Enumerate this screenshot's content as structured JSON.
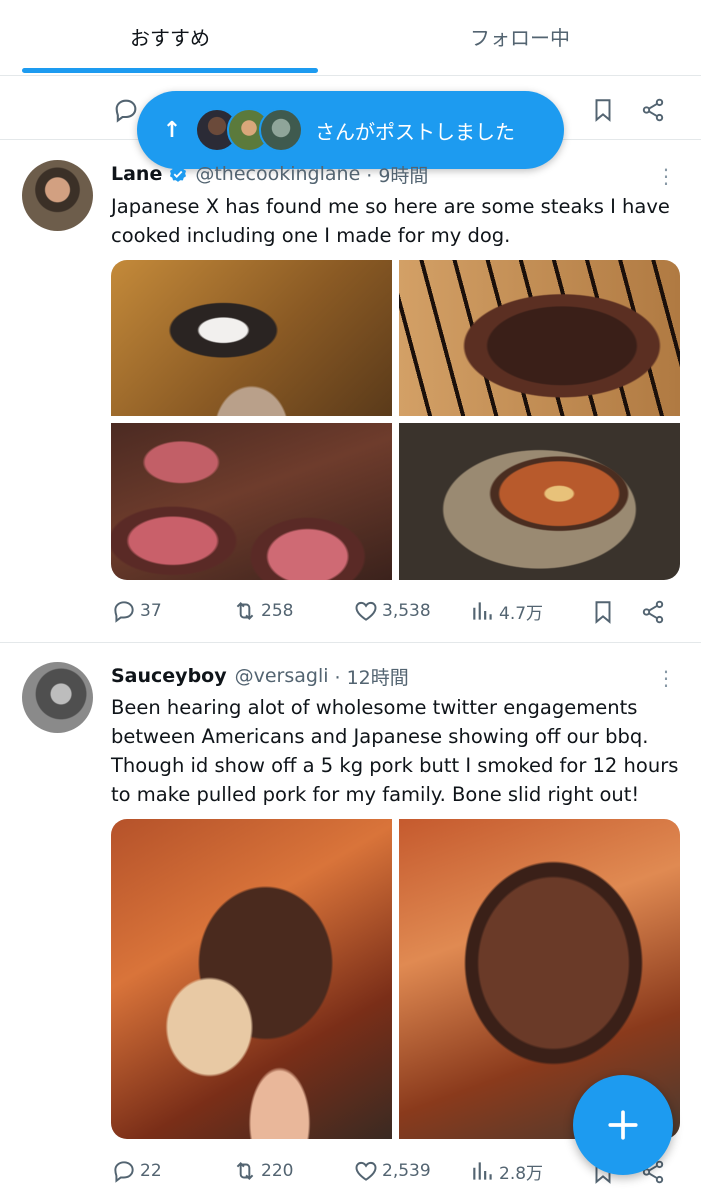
{
  "tabs": [
    {
      "label": "おすすめ"
    },
    {
      "label": "フォロー中"
    }
  ],
  "new_posts_pill": {
    "label": "さんがポストしました"
  },
  "tweets": [
    {
      "name": "Lane",
      "verified": true,
      "handle": "@thecookinglane",
      "time": "· 9時間",
      "text_lines": [
        "Japanese X has found me so here are some steaks I have",
        "cooked including one I made for my dog."
      ],
      "images": [
        "dog-on-tile-floor",
        "grilled-tomahawk-steak",
        "sliced-beef-tenderloin",
        "steak-in-cast-iron-pan"
      ],
      "replies": "37",
      "reposts": "258",
      "likes": "3,538",
      "views": "4.7万"
    },
    {
      "name": "Sauceyboy",
      "verified": false,
      "handle": "@versagli",
      "time": "· 12時間",
      "text_lines": [
        "Been hearing alot of wholesome twitter engagements",
        "between Americans and Japanese showing off our bbq.",
        "Though id show off a 5 kg pork butt I smoked for 12 hours",
        "to make pulled pork for my family. Bone slid right out!"
      ],
      "images": [
        "pork-butt-with-bone",
        "smoked-pork-butt"
      ],
      "replies": "22",
      "reposts": "220",
      "likes": "2,539",
      "views": "2.8万"
    }
  ],
  "icons": {
    "reply": "reply-icon",
    "repost": "repost-icon",
    "like": "heart-icon",
    "views": "views-icon",
    "bookmark": "bookmark-icon",
    "share": "share-icon",
    "compose": "plus-icon"
  },
  "colors": {
    "accent": "#1d9bf0",
    "text": "#0f1419",
    "muted": "#536471"
  }
}
